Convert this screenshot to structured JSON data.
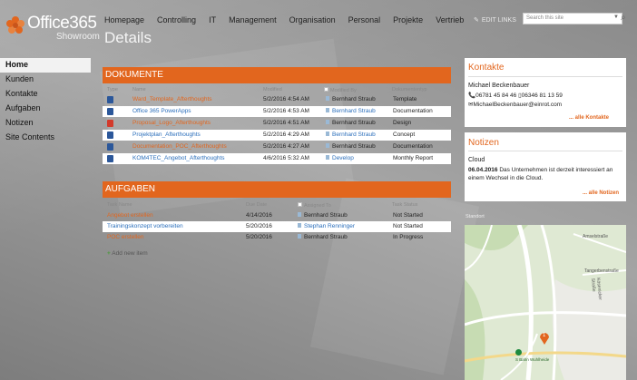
{
  "site": {
    "brand": "Office365",
    "subtitle": "Showroom",
    "page_title": "Details"
  },
  "topnav": {
    "items": [
      "Homepage",
      "Controlling",
      "IT",
      "Management",
      "Organisation",
      "Personal",
      "Projekte",
      "Vertrieb"
    ],
    "edit_links": "EDIT LINKS",
    "search_placeholder": "Search this site"
  },
  "leftnav": {
    "items": [
      "Home",
      "Kunden",
      "Kontakte",
      "Aufgaben",
      "Notizen",
      "Site Contents"
    ],
    "selected": "Home"
  },
  "dokumente": {
    "title": "DOKUMENTE",
    "columns": [
      "Type",
      "Name",
      "Modified",
      "Modified By",
      "Dokumententyp"
    ],
    "rows": [
      {
        "icon": "word",
        "name": "Ward_Template_Afterthoughts",
        "modified": "5/2/2016 4:54 AM",
        "by": "Bernhard Straub",
        "type": "Template",
        "color": "orange"
      },
      {
        "icon": "word",
        "name": "Office 365 PowerApps",
        "modified": "5/2/2016 4:53 AM",
        "by": "Bernhard Straub",
        "type": "Documentation",
        "color": "blue"
      },
      {
        "icon": "pdf",
        "name": "Proposal_Logo_Afterthoughts",
        "modified": "5/2/2016 4:51 AM",
        "by": "Bernhard Straub",
        "type": "Design",
        "color": "orange"
      },
      {
        "icon": "word",
        "name": "Projektplan_Afterthoughts",
        "modified": "5/2/2016 4:29 AM",
        "by": "Bernhard Straub",
        "type": "Concept",
        "color": "blue"
      },
      {
        "icon": "word",
        "name": "Documentation_POC_Afterthoughts",
        "modified": "5/2/2016 4:27 AM",
        "by": "Bernhard Straub",
        "type": "Documentation",
        "color": "orange"
      },
      {
        "icon": "word",
        "name": "KOM4TEC_Angebot_Afterthoughts",
        "modified": "4/6/2016 5:32 AM",
        "by": "Develop",
        "type": "Monthly Report",
        "color": "blue"
      }
    ]
  },
  "aufgaben": {
    "title": "AUFGABEN",
    "columns": [
      "Task Name",
      "Due Date",
      "Assigned To",
      "Task Status"
    ],
    "rows": [
      {
        "name": "Angebot erstellen",
        "due": "4/14/2016",
        "assigned": "Bernhard Straub",
        "status": "Not Started",
        "color": "orange"
      },
      {
        "name": "Trainingskonzept vorbereiten",
        "due": "5/20/2016",
        "assigned": "Stephan Renninger",
        "status": "Not Started",
        "color": "blue"
      },
      {
        "name": "POC erstellen",
        "due": "5/20/2016",
        "assigned": "Bernhard Straub",
        "status": "In Progress",
        "color": "orange"
      }
    ],
    "add_item": "Add new item"
  },
  "kontakte": {
    "title": "Kontakte",
    "name": "Michael Beckenbauer",
    "phones": "06781 45 84 46",
    "mobile": "06346 81 13 59",
    "email": "MichaelBeckenbauer@einrot.com",
    "more": "... alle Kontakte"
  },
  "notizen": {
    "title": "Notizen",
    "heading": "Cloud",
    "date": "06.04.2016",
    "text_line1": "Das Unternehmen ist derzeit interessiert an",
    "text_line2": "einem Wechsel in die Cloud.",
    "more": "... alle Notizen"
  },
  "map": {
    "label": "Standort",
    "marker": "1",
    "streets": [
      "Kösenicker Straße",
      "Tangerbenstraße",
      "Amselstraße",
      "S Bahn Wuhlheide"
    ]
  },
  "colors": {
    "accent": "#e2661e",
    "link": "#2a6ebb"
  }
}
